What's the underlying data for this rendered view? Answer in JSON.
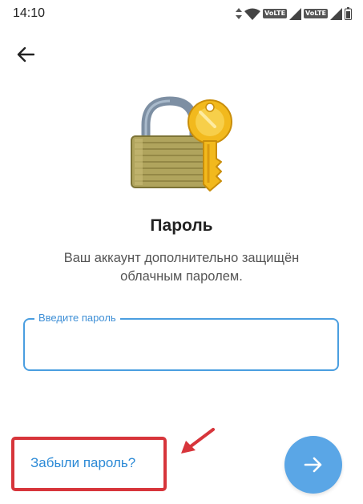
{
  "status_bar": {
    "time": "14:10",
    "network_badge_1": "VoLTE",
    "network_badge_2": "VoLTE"
  },
  "header": {
    "back_icon": "arrow-left-icon"
  },
  "illustration": {
    "name": "padlock-with-key-icon"
  },
  "title": "Пароль",
  "subtitle_line1": "Ваш аккаунт дополнительно защищён",
  "subtitle_line2": "облачным паролем.",
  "password_field": {
    "label": "Введите пароль",
    "value": ""
  },
  "forgot_password": "Забыли пароль?",
  "next_button": {
    "icon": "arrow-right-icon"
  },
  "colors": {
    "accent": "#4a9ee0",
    "link": "#2c8ad6",
    "fab": "#5aa6e6",
    "highlight": "#d7353b"
  }
}
